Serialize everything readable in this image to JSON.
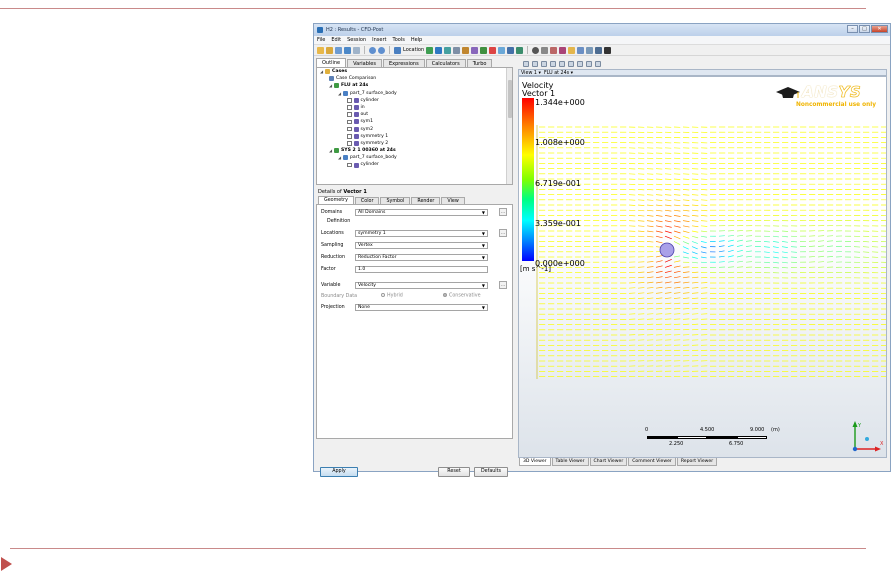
{
  "window": {
    "title": "H2 : Results - CFD-Post",
    "controls": {
      "minimize": "–",
      "maximize": "□",
      "close": "✕"
    }
  },
  "menu": [
    "File",
    "Edit",
    "Session",
    "Insert",
    "Tools",
    "Help"
  ],
  "toolbar": {
    "location_label": "Location"
  },
  "outline": {
    "tabs": [
      "Outline",
      "Variables",
      "Expressions",
      "Calculators",
      "Turbo"
    ],
    "active_tab": "Outline",
    "tree": [
      {
        "label": "Cases",
        "level": 0,
        "bold": true,
        "icon": "folder-icon",
        "arrow": "◢"
      },
      {
        "label": "Case Comparison",
        "level": 1,
        "bold": false,
        "icon": "compare-icon",
        "arrow": ""
      },
      {
        "label": "FLU at 24s",
        "level": 1,
        "bold": true,
        "icon": "case-icon",
        "arrow": "◢"
      },
      {
        "label": "part_7 surface_body",
        "level": 2,
        "bold": false,
        "icon": "domain-icon",
        "arrow": "◢"
      },
      {
        "label": "cylinder",
        "level": 3,
        "bold": false,
        "icon": "boundary-icon",
        "check": true
      },
      {
        "label": "in",
        "level": 3,
        "bold": false,
        "icon": "boundary-icon",
        "check": true
      },
      {
        "label": "out",
        "level": 3,
        "bold": false,
        "icon": "boundary-icon",
        "check": true
      },
      {
        "label": "sym1",
        "level": 3,
        "bold": false,
        "icon": "boundary-icon",
        "check": true
      },
      {
        "label": "sym2",
        "level": 3,
        "bold": false,
        "icon": "boundary-icon",
        "check": true
      },
      {
        "label": "symmetry 1",
        "level": 3,
        "bold": false,
        "icon": "boundary-icon",
        "check": true
      },
      {
        "label": "symmetry 2",
        "level": 3,
        "bold": false,
        "icon": "boundary-icon",
        "check": true
      },
      {
        "label": "SYS 2 1 00360 at 24s",
        "level": 1,
        "bold": true,
        "icon": "case-icon",
        "arrow": "◢"
      },
      {
        "label": "part_7 surface_body",
        "level": 2,
        "bold": false,
        "icon": "domain-icon",
        "arrow": "◢"
      },
      {
        "label": "cylinder",
        "level": 3,
        "bold": false,
        "icon": "boundary-icon",
        "check": true
      }
    ]
  },
  "details": {
    "title_prefix": "Details of ",
    "title_object": "Vector 1",
    "tabs": [
      "Geometry",
      "Color",
      "Symbol",
      "Render",
      "View"
    ],
    "active_tab": "Geometry",
    "domains_label": "Domains",
    "domains_value": "All Domains",
    "definition_label": "Definition",
    "locations_label": "Locations",
    "locations_value": "symmetry 1",
    "sampling_label": "Sampling",
    "sampling_value": "Vertex",
    "reduction_label": "Reduction",
    "reduction_value": "Reduction Factor",
    "factor_label": "Factor",
    "factor_value": "1.0",
    "variable_label": "Variable",
    "variable_value": "Velocity",
    "boundary_label": "Boundary Data",
    "hybrid_label": "Hybrid",
    "conservative_label": "Conservative",
    "projection_label": "Projection",
    "projection_value": "None",
    "ellipsis": "...",
    "apply": "Apply",
    "reset": "Reset",
    "defaults": "Defaults"
  },
  "viewer": {
    "view_selector": "View 1 ▾",
    "case_selector": "FLU at 24s ▾",
    "legend": {
      "title": "Velocity",
      "subtitle": "Vector 1",
      "ticks": [
        "1.344e+000",
        "1.008e+000",
        "6.719e-001",
        "3.359e-001",
        "0.000e+000"
      ],
      "units": "[m s^-1]"
    },
    "brand": {
      "name_a": "ANS",
      "name_b": "YS",
      "note": "Noncommercial use only"
    },
    "scale": {
      "top": [
        "0",
        "4.500",
        "9.000"
      ],
      "unit": "(m)",
      "bottom": [
        "2.250",
        "6.750"
      ]
    },
    "axes": {
      "x": "X",
      "y": "Y"
    },
    "bottom_tabs": [
      "3D Viewer",
      "Table Viewer",
      "Chart Viewer",
      "Comment Viewer",
      "Report Viewer"
    ],
    "active_bottom_tab": "3D Viewer"
  },
  "colors": {
    "accent_line": "#c98a8a",
    "slide_marker": "#c0504d",
    "ansys_gold": "#f0b400"
  }
}
